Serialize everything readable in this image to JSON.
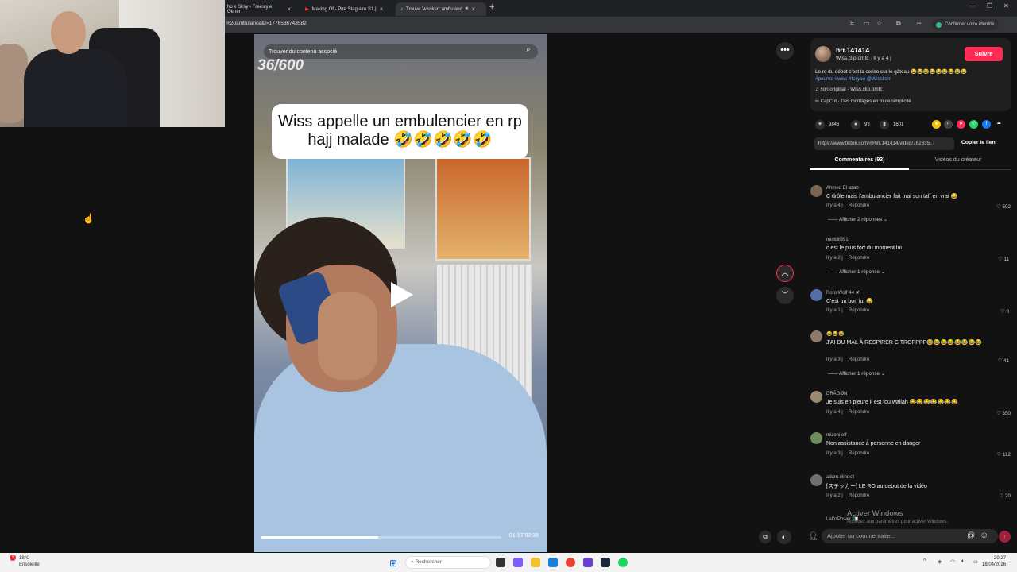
{
  "browser": {
    "tabs": [
      {
        "label": "ho x Sirsy - Freestyle Gener",
        "active": false
      },
      {
        "label": "Making Of - Pire Stagiaire S1 |",
        "active": false
      },
      {
        "label": "Trouve 'wissksrr ambulanc",
        "active": true
      }
    ],
    "address_url": "%20ambulance&t=1776536743582",
    "identity_button": "Confirmer votre identité"
  },
  "video": {
    "search_placeholder": "Trouver du contenu associé",
    "counter_text": "36/600",
    "caption": "Wiss appelle un embulencier en rp hajj malade 🤣🤣🤣🤣🤣",
    "time": "01:17/02:38",
    "progress": 0.49
  },
  "post": {
    "author": "hrr.141414",
    "author_sub": "Wiss.clip.omtc · Il y a 4 j",
    "follow_label": "Suivre",
    "description": "Le ro du début c'est la cerise sur le gâteau 😂😂😂😂😂😂😂😂😂",
    "hashtags": "#pourtoi #wiss #foryou @Wissksrr",
    "music": "son original - Wiss.clip.omtc",
    "capcut": "CapCut · Des montages en toute simplicité",
    "likes": "9846",
    "comments": "93",
    "saves": "1601",
    "link": "https://www.tiktok.com/@hrr.141414/video/762835...",
    "copy_link_label": "Copier le lien",
    "tab_comments": "Commentaires (93)",
    "tab_videos": "Vidéos du créateur"
  },
  "comments": [
    {
      "user": "Ahmed El azab",
      "text": "C drôle mais l'ambulancier fait mal son taff en vrai 😂",
      "time": "Il y a 4 j",
      "reply": "Répondre",
      "likes": "592",
      "replies": "Afficher 2 réponses"
    },
    {
      "user": "mickiiii691",
      "text": "c est le plus fort du moment lui",
      "time": "Il y a 2 j",
      "reply": "Répondre",
      "likes": "11",
      "replies": "Afficher 1 réponse"
    },
    {
      "user": "Roro Wolf 44 ✘",
      "text": "C'est un bon lui 😂",
      "time": "Il y a 1 j",
      "reply": "Répondre",
      "likes": "0",
      "replies": ""
    },
    {
      "user": "😂😂😂",
      "text": "J'AI DU MAL À RESPIRER C TROPPPP😂😂😂😂😂😂😂😂",
      "time": "Il y a 3 j",
      "reply": "Répondre",
      "likes": "41",
      "replies": "Afficher 1 réponse"
    },
    {
      "user": "DRĀGØN",
      "text": "Je suis en pleure il est fou wallah 😂😂😂😂😂😂😂",
      "time": "Il y a 4 j",
      "reply": "Répondre",
      "likes": "350",
      "replies": ""
    },
    {
      "user": "mizoni.off",
      "text": "Non assistance à personne en danger",
      "time": "Il y a 3 j",
      "reply": "Répondre",
      "likes": "112",
      "replies": ""
    },
    {
      "user": "adam.elindsfi",
      "text": "[ステッカー] LE RO au debut de la vidéo",
      "time": "Il y a 2 j",
      "reply": "Répondre",
      "likes": "20",
      "replies": ""
    },
    {
      "user": "LaDzPower 🇩🇿",
      "text": "",
      "time": "",
      "reply": "",
      "likes": "",
      "replies": ""
    }
  ],
  "comment_box_placeholder": "Ajouter un commentaire...",
  "watermark": {
    "line1": "Activer Windows",
    "line2": "Accédez aux paramètres pour activer Windows."
  },
  "taskbar": {
    "weather_temp": "18°C",
    "weather_desc": "Ensoleillé",
    "weather_badge": "1",
    "search_placeholder": "Rechercher",
    "time": "20:27",
    "date": "18/04/2026"
  },
  "colors": {
    "accent": "#fe2c55",
    "link": "#6fa8ff",
    "background": "#121212"
  }
}
